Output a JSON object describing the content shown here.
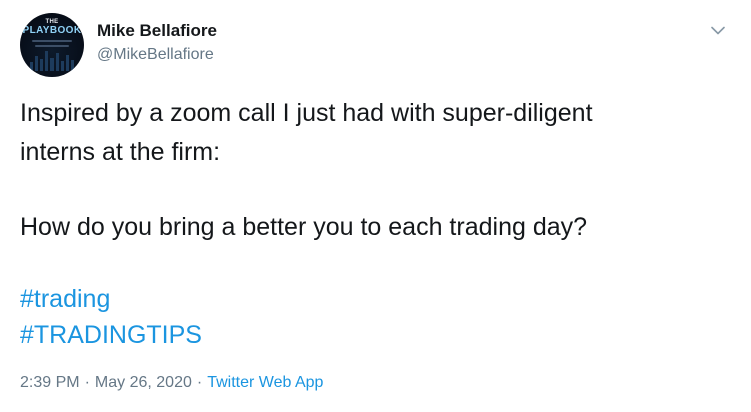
{
  "author": {
    "name": "Mike Bellafiore",
    "handle": "@MikeBellafiore",
    "avatar_text_top": "THE",
    "avatar_text_brand": "PLAYBOOK"
  },
  "menu": {
    "icon": "chevron-down-icon"
  },
  "tweet": {
    "line1": "Inspired by a zoom call I just had with super-diligent",
    "line2": "interns at the firm:",
    "line3": "How do you bring a better you to each trading day?",
    "hashtags": [
      "#trading",
      "#TRADINGTIPS"
    ]
  },
  "meta": {
    "time": "2:39 PM",
    "separator": "·",
    "date": "May 26, 2020",
    "source": "Twitter Web App"
  },
  "colors": {
    "link": "#1b95e0",
    "text": "#14171a",
    "muted": "#657786"
  }
}
